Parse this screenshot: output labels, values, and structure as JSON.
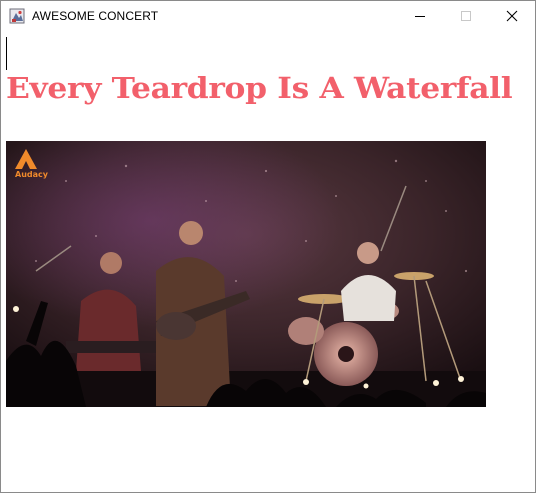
{
  "window": {
    "title": "AWESOME CONCERT",
    "controls": {
      "minimize_icon": "minimize-icon",
      "maximize_icon": "maximize-icon",
      "close_icon": "close-icon"
    }
  },
  "main": {
    "song_title": "Every Teardrop Is A Waterfall",
    "title_color": "#f2606b",
    "video": {
      "watermark_logo": "Audacy"
    }
  }
}
